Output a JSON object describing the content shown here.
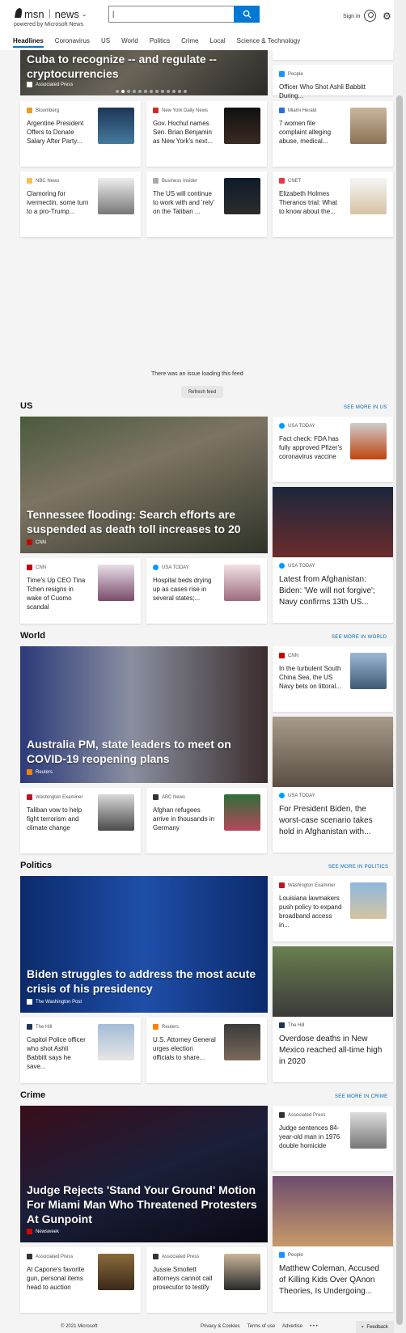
{
  "header": {
    "logo_msn": "msn",
    "logo_news": "news",
    "powered_by": "powered by Microsoft News",
    "search_value": "|",
    "sign_in": "Sign in"
  },
  "nav": [
    "Headlines",
    "Coronavirus",
    "US",
    "World",
    "Politics",
    "Crime",
    "Local",
    "Science & Technology"
  ],
  "top": {
    "hero": {
      "title": "Cuba to recognize -- and regulate -- cryptocurrencies",
      "source": "Associated Press"
    },
    "side": {
      "source": "People",
      "title": "Officer Who Shot Ashli Babbitt During..."
    },
    "row1": [
      {
        "source": "Bloomberg",
        "title": "Argentine President Offers to Donate Salary After Party..."
      },
      {
        "source": "New York Daily News",
        "title": "Gov. Hochul names Sen. Brian Benjamin as New York's next..."
      },
      {
        "source": "Miami Herald",
        "title": "7 women file complaint alleging abuse, medical..."
      }
    ],
    "row2": [
      {
        "source": "NBC News",
        "title": "Clamoring for ivermectin, some turn to a pro-Trump..."
      },
      {
        "source": "Business Insider",
        "title": "The US will continue to work with and 'rely' on the Taliban ..."
      },
      {
        "source": "CNET",
        "title": "Elizabeth Holmes Theranos trial: What to know about the..."
      }
    ]
  },
  "feed_error": {
    "message": "There was an issue loading this feed",
    "refresh": "Refresh feed"
  },
  "sections": {
    "us": {
      "title": "US",
      "see_more": "SEE MORE IN US",
      "hero": {
        "title": "Tennessee flooding: Search efforts are suspended as death toll increases to 20",
        "source": "CNN"
      },
      "side1": {
        "source": "USA TODAY",
        "title": "Fact check: FDA has fully approved Pfizer's coronavirus vaccine"
      },
      "side2": {
        "source": "USA TODAY",
        "title": "Latest from Afghanistan: Biden: 'We will not forgive'; Navy confirms 13th US..."
      },
      "small": [
        {
          "source": "CNN",
          "title": "Time's Up CEO Tina Tchen resigns in wake of Cuomo scandal"
        },
        {
          "source": "USA TODAY",
          "title": "Hospital beds drying up as cases rise in several states;..."
        }
      ]
    },
    "world": {
      "title": "World",
      "see_more": "SEE MORE IN WORLD",
      "hero": {
        "title": "Australia PM, state leaders to meet on COVID-19 reopening plans",
        "source": "Reuters"
      },
      "side1": {
        "source": "CNN",
        "title": "In the turbulent South China Sea, the US Navy bets on littoral..."
      },
      "side2": {
        "source": "USA TODAY",
        "title": "For President Biden, the worst-case scenario takes hold in Afghanistan with..."
      },
      "small": [
        {
          "source": "Washington Examiner",
          "title": "Taliban vow to help fight terrorism and climate change"
        },
        {
          "source": "ABC News",
          "title": "Afghan refugees arrive in thousands in Germany"
        }
      ]
    },
    "politics": {
      "title": "Politics",
      "see_more": "SEE MORE IN POLITICS",
      "hero": {
        "title": "Biden struggles to address the most acute crisis of his presidency",
        "source": "The Washington Post"
      },
      "side1": {
        "source": "Washington Examiner",
        "title": "Louisiana lawmakers push policy to expand broadband access in..."
      },
      "side2": {
        "source": "The Hill",
        "title": "Overdose deaths in New Mexico reached all-time high in 2020"
      },
      "small": [
        {
          "source": "The Hill",
          "title": "Capitol Police officer who shot Ashli Babbitt says he save..."
        },
        {
          "source": "Reuters",
          "title": "U.S. Attorney General urges election officials to share..."
        }
      ]
    },
    "crime": {
      "title": "Crime",
      "see_more": "SEE MORE IN CRIME",
      "hero": {
        "title": "Judge Rejects 'Stand Your Ground' Motion For Miami Man Who Threatened Protesters At Gunpoint",
        "source": "Newsweek"
      },
      "side1": {
        "source": "Associated Press",
        "title": "Judge sentences 84-year-old man in 1976 double homicide"
      },
      "side2": {
        "source": "People",
        "title": "Matthew Coleman, Accused of Killing Kids Over QAnon Theories, Is Undergoing..."
      },
      "small": [
        {
          "source": "Associated Press",
          "title": "Al Capone's favorite gun, personal items head to auction"
        },
        {
          "source": "Associated Press",
          "title": "Jussie Smollett attorneys cannot call prosecutor to testify"
        }
      ]
    }
  },
  "footer": {
    "copyright": "© 2021 Microsoft",
    "links": [
      "Privacy & Cookies",
      "Terms of use",
      "Advertise",
      "• • •"
    ],
    "feedback": "Feedback"
  }
}
